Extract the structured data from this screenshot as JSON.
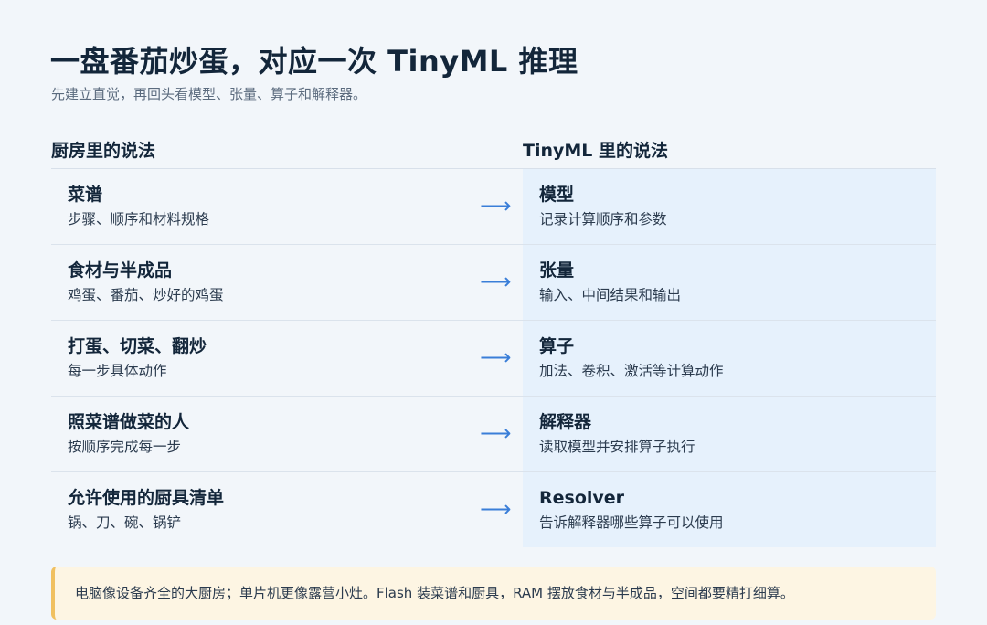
{
  "title": "一盘番茄炒蛋，对应一次 TinyML 推理",
  "subtitle": "先建立直觉，再回头看模型、张量、算子和解释器。",
  "columns": {
    "left": "厨房里的说法",
    "right": "TinyML 里的说法"
  },
  "arrow_symbol": "⟶",
  "rows": [
    {
      "kitchen_term": "菜谱",
      "kitchen_desc": "步骤、顺序和材料规格",
      "tinyml_term": "模型",
      "tinyml_desc": "记录计算顺序和参数"
    },
    {
      "kitchen_term": "食材与半成品",
      "kitchen_desc": "鸡蛋、番茄、炒好的鸡蛋",
      "tinyml_term": "张量",
      "tinyml_desc": "输入、中间结果和输出"
    },
    {
      "kitchen_term": "打蛋、切菜、翻炒",
      "kitchen_desc": "每一步具体动作",
      "tinyml_term": "算子",
      "tinyml_desc": "加法、卷积、激活等计算动作"
    },
    {
      "kitchen_term": "照菜谱做菜的人",
      "kitchen_desc": "按顺序完成每一步",
      "tinyml_term": "解释器",
      "tinyml_desc": "读取模型并安排算子执行"
    },
    {
      "kitchen_term": "允许使用的厨具清单",
      "kitchen_desc": "锅、刀、碗、锅铲",
      "tinyml_term": "Resolver",
      "tinyml_desc": "告诉解释器哪些算子可以使用"
    }
  ],
  "note": "电脑像设备齐全的大厨房；单片机更像露营小灶。Flash 装菜谱和厨具，RAM 摆放食材与半成品，空间都要精打细算。",
  "colors": {
    "background": "#f2f6fa",
    "right_cell": "#e6f1fc",
    "arrow": "#3a7ed8",
    "note_background": "#fdf5e3",
    "note_border": "#f0c060"
  }
}
